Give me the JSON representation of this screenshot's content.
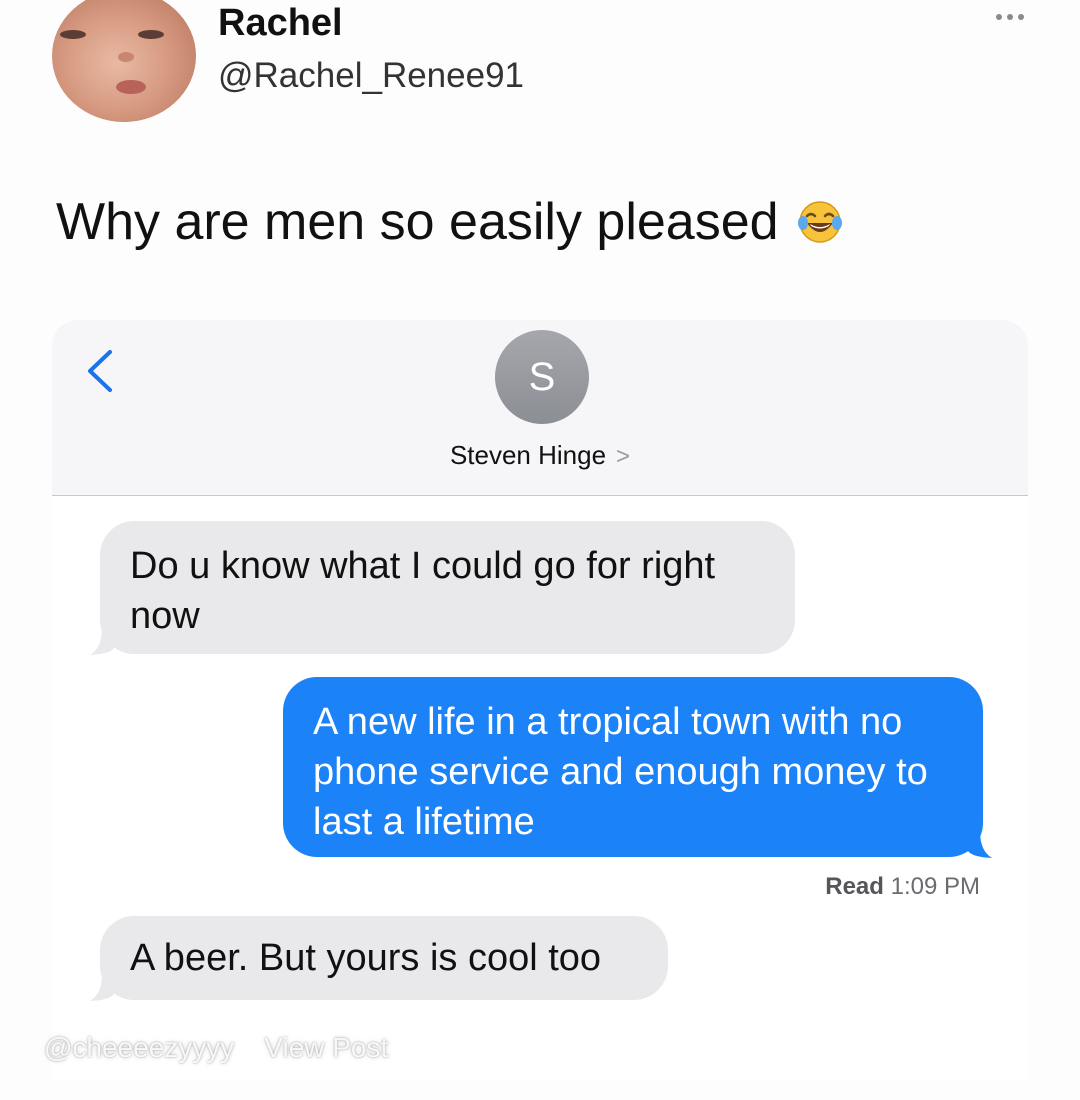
{
  "tweet": {
    "display_name": "Rachel",
    "handle": "@Rachel_Renee91",
    "text": "Why are men so easily pleased",
    "emoji_icon": "face-with-tears-of-joy-icon",
    "more_icon": "more-options-icon"
  },
  "messages": {
    "back_icon": "chevron-left-icon",
    "contact_initial": "S",
    "contact_name": "Steven Hinge",
    "contact_chevron": ">",
    "thread": [
      {
        "direction": "incoming",
        "text": "Do u know what I could go for right now"
      },
      {
        "direction": "outgoing",
        "text": "A new life in a tropical town with no phone service and enough money to last a lifetime"
      },
      {
        "direction": "incoming",
        "text": "A beer. But yours is cool too"
      }
    ],
    "read_receipt": {
      "label": "Read",
      "time": "1:09 PM"
    },
    "colors": {
      "outgoing_bubble": "#1b82f8",
      "incoming_bubble": "#e9e9eb",
      "accent": "#1a73e8"
    }
  },
  "watermark": {
    "username": "@cheeeezyyyy",
    "view_post": "View Post"
  }
}
